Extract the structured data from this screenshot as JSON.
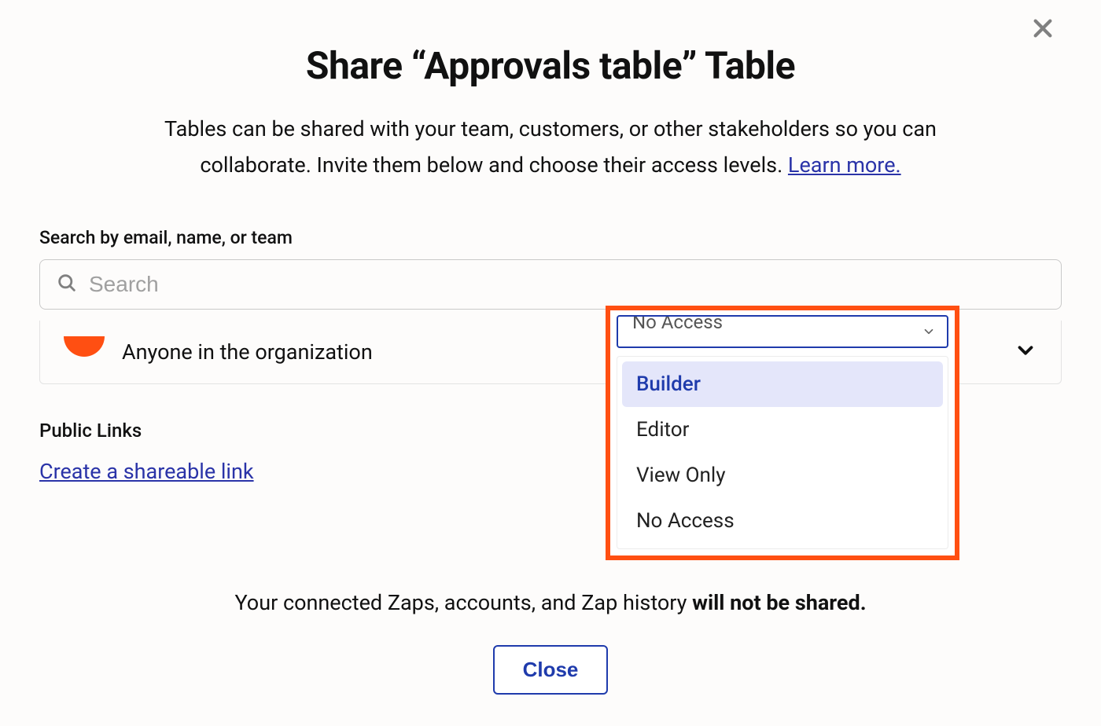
{
  "modal": {
    "title": "Share “Approvals table” Table",
    "subtitle_lead": "Tables can be shared with your team, customers, or other stakeholders so you can collaborate. Invite them below and choose their access levels. ",
    "learn_more": "Learn more.",
    "search_label": "Search by email, name, or team",
    "search_placeholder": "Search",
    "org_row_label": "Anyone in the organization",
    "access_selected": "No Access",
    "access_options": [
      "Builder",
      "Editor",
      "View Only",
      "No Access"
    ],
    "public_links_title": "Public Links",
    "create_link": "Create a shareable link",
    "footer_lead": "Your connected Zaps, accounts, and Zap history ",
    "footer_strong": "will not be shared.",
    "close_button": "Close"
  }
}
